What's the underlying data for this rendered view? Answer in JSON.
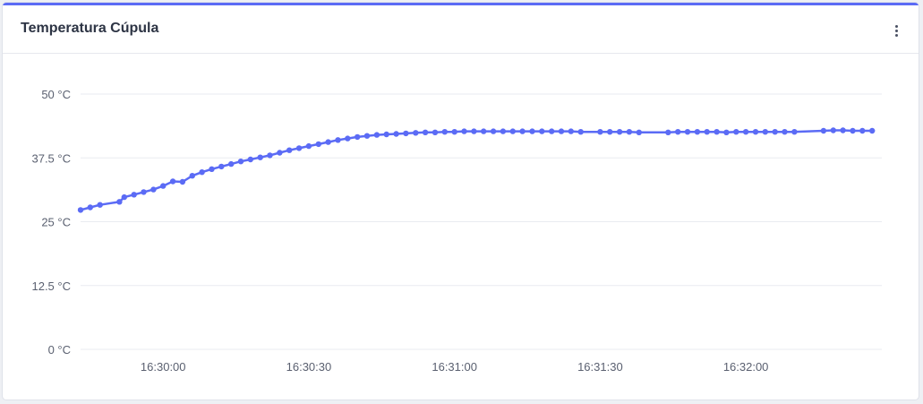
{
  "panel": {
    "title": "Temperatura Cúpula",
    "menu_icon": "vertical-dots-icon"
  },
  "colors": {
    "accent": "#5b6bf5",
    "grid": "#e9ebf0",
    "axis_text": "#5a6070"
  },
  "chart_data": {
    "type": "line",
    "title": "Temperatura Cúpula",
    "xlabel": "",
    "ylabel": "",
    "y_unit": "°C",
    "ylim": [
      0,
      50
    ],
    "y_ticks": [
      0,
      12.5,
      25,
      37.5,
      50
    ],
    "y_tick_labels": [
      "0 °C",
      "12.5 °C",
      "25 °C",
      "37.5 °C",
      "50 °C"
    ],
    "x_ticks": [
      "16:30:00",
      "16:30:30",
      "16:31:00",
      "16:31:30",
      "16:32:00"
    ],
    "x_range": [
      "16:29:43",
      "16:32:28"
    ],
    "grid": true,
    "legend": "none",
    "series": [
      {
        "points": [
          [
            "16:29:43",
            27.3
          ],
          [
            "16:29:45",
            27.8
          ],
          [
            "16:29:47",
            28.3
          ],
          [
            "16:29:51",
            28.9
          ],
          [
            "16:29:52",
            29.8
          ],
          [
            "16:29:54",
            30.3
          ],
          [
            "16:29:56",
            30.8
          ],
          [
            "16:29:58",
            31.3
          ],
          [
            "16:30:00",
            32.0
          ],
          [
            "16:30:02",
            32.9
          ],
          [
            "16:30:04",
            32.8
          ],
          [
            "16:30:06",
            34.0
          ],
          [
            "16:30:08",
            34.7
          ],
          [
            "16:30:10",
            35.3
          ],
          [
            "16:30:12",
            35.8
          ],
          [
            "16:30:14",
            36.3
          ],
          [
            "16:30:16",
            36.8
          ],
          [
            "16:30:18",
            37.2
          ],
          [
            "16:30:20",
            37.6
          ],
          [
            "16:30:22",
            38.0
          ],
          [
            "16:30:24",
            38.5
          ],
          [
            "16:30:26",
            39.0
          ],
          [
            "16:30:28",
            39.4
          ],
          [
            "16:30:30",
            39.8
          ],
          [
            "16:30:32",
            40.2
          ],
          [
            "16:30:34",
            40.6
          ],
          [
            "16:30:36",
            41.0
          ],
          [
            "16:30:38",
            41.3
          ],
          [
            "16:30:40",
            41.6
          ],
          [
            "16:30:42",
            41.8
          ],
          [
            "16:30:44",
            42.0
          ],
          [
            "16:30:46",
            42.1
          ],
          [
            "16:30:48",
            42.2
          ],
          [
            "16:30:50",
            42.3
          ],
          [
            "16:30:52",
            42.4
          ],
          [
            "16:30:54",
            42.5
          ],
          [
            "16:30:56",
            42.5
          ],
          [
            "16:30:58",
            42.6
          ],
          [
            "16:31:00",
            42.6
          ],
          [
            "16:31:02",
            42.7
          ],
          [
            "16:31:04",
            42.7
          ],
          [
            "16:31:06",
            42.7
          ],
          [
            "16:31:08",
            42.7
          ],
          [
            "16:31:10",
            42.7
          ],
          [
            "16:31:12",
            42.7
          ],
          [
            "16:31:14",
            42.7
          ],
          [
            "16:31:16",
            42.7
          ],
          [
            "16:31:18",
            42.7
          ],
          [
            "16:31:20",
            42.7
          ],
          [
            "16:31:22",
            42.7
          ],
          [
            "16:31:24",
            42.7
          ],
          [
            "16:31:26",
            42.6
          ],
          [
            "16:31:30",
            42.6
          ],
          [
            "16:31:32",
            42.6
          ],
          [
            "16:31:34",
            42.6
          ],
          [
            "16:31:36",
            42.6
          ],
          [
            "16:31:38",
            42.5
          ],
          [
            "16:31:44",
            42.5
          ],
          [
            "16:31:46",
            42.6
          ],
          [
            "16:31:48",
            42.6
          ],
          [
            "16:31:50",
            42.6
          ],
          [
            "16:31:52",
            42.6
          ],
          [
            "16:31:54",
            42.6
          ],
          [
            "16:31:56",
            42.5
          ],
          [
            "16:31:58",
            42.6
          ],
          [
            "16:32:00",
            42.6
          ],
          [
            "16:32:02",
            42.6
          ],
          [
            "16:32:04",
            42.6
          ],
          [
            "16:32:06",
            42.6
          ],
          [
            "16:32:08",
            42.6
          ],
          [
            "16:32:10",
            42.6
          ],
          [
            "16:32:16",
            42.8
          ],
          [
            "16:32:18",
            42.9
          ],
          [
            "16:32:20",
            42.9
          ],
          [
            "16:32:22",
            42.8
          ],
          [
            "16:32:24",
            42.8
          ],
          [
            "16:32:26",
            42.8
          ]
        ]
      }
    ]
  }
}
